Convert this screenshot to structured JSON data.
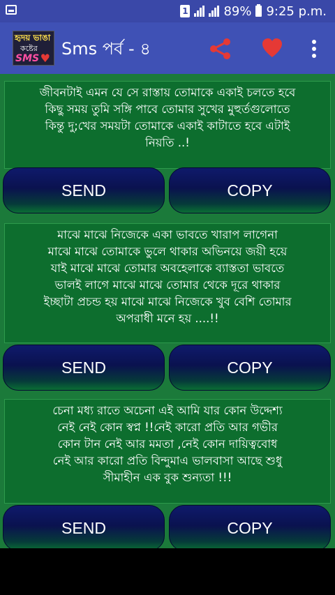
{
  "status_bar": {
    "sim_label": "1",
    "battery_percent": "89%",
    "time": "9:25 p.m."
  },
  "app_bar": {
    "title": "Sms পর্ব - ৪",
    "logo_lines": [
      "হৃদয় ভাঙা",
      "কষ্টের",
      "SMS"
    ],
    "icons": [
      "share-icon",
      "heart-icon",
      "more-vert-icon"
    ],
    "icon_colors": {
      "share": "#e53935",
      "heart": "#e53935",
      "menu": "#ffffff"
    }
  },
  "colors": {
    "status_bar": "#3a48a8",
    "app_bar": "#3f51b5",
    "content_bg": "#1b7a3a",
    "card_bg": "#0d6e2e",
    "button_top": "#0f1a6b",
    "button_bottom": "#0a6e34"
  },
  "messages": [
    {
      "lines": [
        "জীবনটাই এমন যে সে রাস্তায় তোমাকে একাই চলতে হবে",
        "কিছু সময় তুমি সঙ্গি পাবে তোমার সুখের মুহুর্তগুলোতে",
        "কিন্তু দু;খের সময়টা তোমাকে একাই কাটাতে হবে এটাই",
        "নিয়তি ..!"
      ],
      "send_label": "SEND",
      "copy_label": "COPY"
    },
    {
      "lines": [
        "মাঝে মাঝে নিজেকে একা ভাবতে খারাপ লাগেনা",
        "মাঝে মাঝে তোমাকে ভুলে থাকার অভিনয়ে জয়ী হয়ে",
        "যাই মাঝে মাঝে তোমার অবহেলাকে ব্যাস্ততা ভাবতে",
        "ভালই লাগে মাঝে মাঝে তোমার থেকে দূরে থাকার",
        "ইচ্ছাটা প্রচন্ড হয় মাঝে মাঝে নিজেকে খুব বেশি তোমার",
        "অপরাধী মনে হয় ....!!"
      ],
      "send_label": "SEND",
      "copy_label": "COPY"
    },
    {
      "lines": [
        "চেনা মধ্য রাতে অচেনা এই আমি যার কোন উদ্দেশ্য",
        "নেই নেই কোন স্বপ্ন !!নেই কারো প্রতি আর গভীর",
        "কোন টান নেই আর মমতা ,নেই কোন দায়িত্ববোধ",
        "নেই আর কারো প্রতি বিন্দুমাএ ভালবাসা আছে শুধু",
        "সীমাহীন এক বুক শুন্যতা !!!"
      ],
      "send_label": "SEND",
      "copy_label": "COPY"
    }
  ]
}
